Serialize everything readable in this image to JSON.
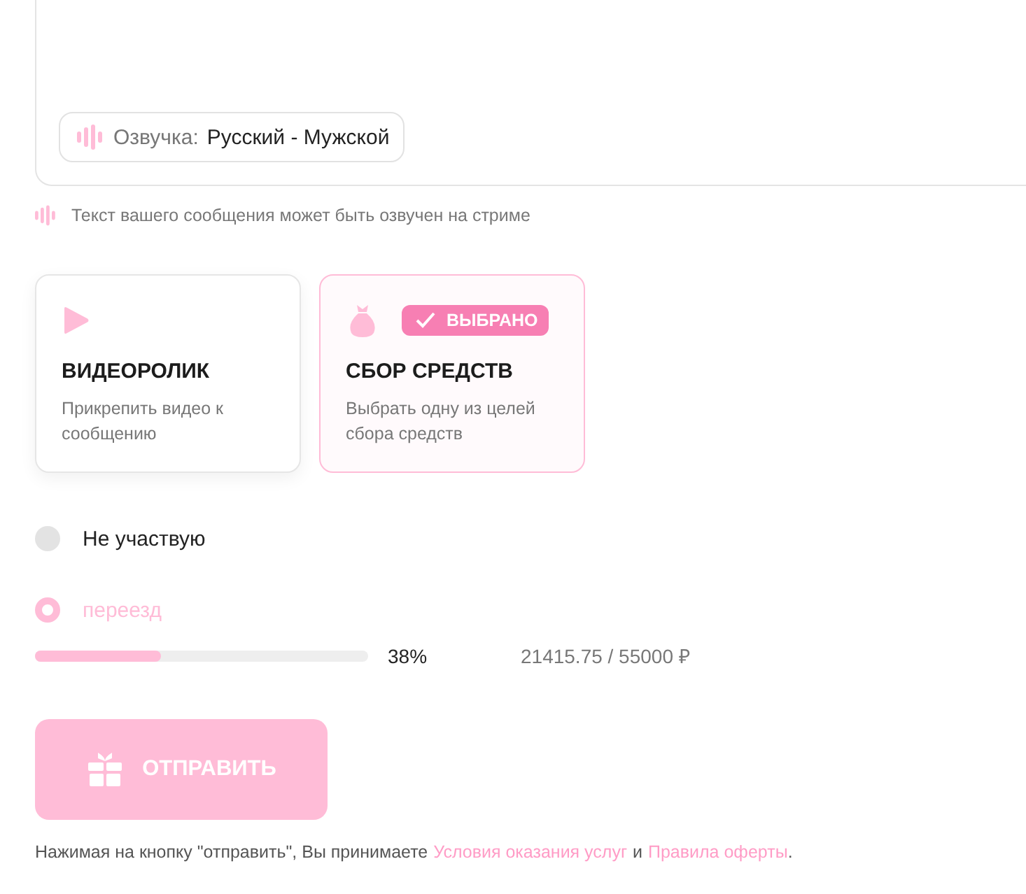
{
  "message_box": {
    "voice": {
      "label": "Озвучка:",
      "value": "Русский - Мужской"
    }
  },
  "voice_hint": "Текст вашего сообщения может быть озвучен на стриме",
  "attachments": [
    {
      "kind": "video",
      "title": "ВИДЕОРОЛИК",
      "description": "Прикрепить видео к сообщению",
      "selected": false
    },
    {
      "kind": "fundraising",
      "title": "СБОР СРЕДСТВ",
      "description": "Выбрать одну из целей сбора средств",
      "selected": true,
      "badge": "ВЫБРАНО"
    }
  ],
  "goals": [
    {
      "label": "Не участвую",
      "selected": false
    },
    {
      "label": "переезд",
      "selected": true,
      "level": 0.38,
      "percent": "38%",
      "amount": "21415.75 / 55000 ₽"
    }
  ],
  "submit_button": "ОТПРАВИТЬ",
  "footer": [
    {
      "kind": "text",
      "text": "Нажимая на кнопку \"отправить\", Вы принимаете"
    },
    {
      "kind": "link",
      "text": "Условия оказания услуг"
    },
    {
      "kind": "text",
      "text": "и"
    },
    {
      "kind": "link",
      "text": "Правила оферты"
    },
    {
      "kind": "end",
      "text": "."
    }
  ]
}
